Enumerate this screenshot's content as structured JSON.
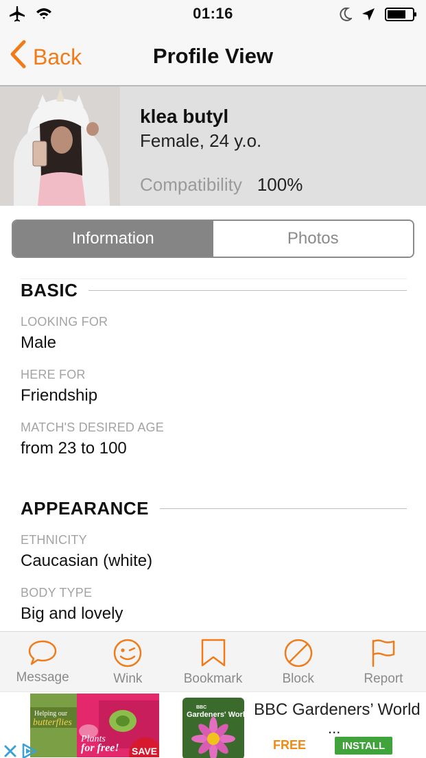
{
  "status_bar": {
    "time": "01:16",
    "icons": [
      "airplane-icon",
      "wifi-icon",
      "moon-icon",
      "location-arrow-icon",
      "battery-icon"
    ]
  },
  "nav": {
    "back_label": "Back",
    "title": "Profile View"
  },
  "profile": {
    "name": "klea butyl",
    "meta": "Female, 24 y.o.",
    "compatibility_label": "Compatibility",
    "compatibility_value": "100%"
  },
  "tabs": {
    "information": "Information",
    "photos": "Photos",
    "selected": "Information"
  },
  "sections": {
    "basic": {
      "title": "BASIC",
      "fields": [
        {
          "label": "LOOKING FOR",
          "value": "Male"
        },
        {
          "label": "HERE FOR",
          "value": "Friendship"
        },
        {
          "label": "MATCH'S DESIRED AGE",
          "value": "from 23 to 100"
        }
      ]
    },
    "appearance": {
      "title": "APPEARANCE",
      "fields": [
        {
          "label": "ETHNICITY",
          "value": "Caucasian (white)"
        },
        {
          "label": "BODY TYPE",
          "value": "Big and lovely"
        }
      ]
    }
  },
  "actions": [
    {
      "label": "Message",
      "icon": "speech-bubble-icon"
    },
    {
      "label": "Wink",
      "icon": "wink-face-icon"
    },
    {
      "label": "Bookmark",
      "icon": "bookmark-icon"
    },
    {
      "label": "Block",
      "icon": "block-icon"
    },
    {
      "label": "Report",
      "icon": "flag-icon"
    }
  ],
  "ad": {
    "title": "BBC Gardeners’ World",
    "ellipsis": "...",
    "price": "FREE",
    "install_label": "INSTALL",
    "image_text": {
      "save": "SAVE",
      "plants": "Plants",
      "for_free": "for free!",
      "helping": "Helping our",
      "butterflies": "butterflies",
      "cover_bbc": "BBC",
      "cover_title": "Gardeners' World"
    }
  },
  "colors": {
    "accent": "#f07b1a",
    "header_bg": "#e0e0e0",
    "segment_active": "#858585",
    "install_green": "#41a33c"
  }
}
